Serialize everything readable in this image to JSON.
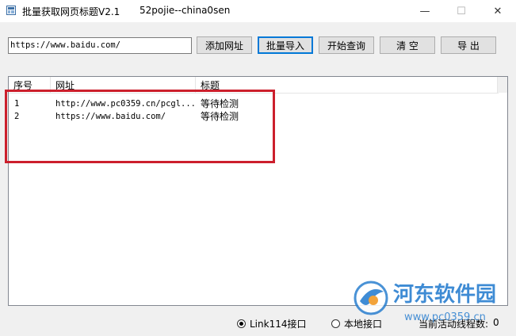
{
  "window": {
    "title": "批量获取网页标题V2.1",
    "subtitle": "52pojie--china0sen",
    "minimize_glyph": "—",
    "maximize_glyph": "☐",
    "close_glyph": "✕"
  },
  "toolbar": {
    "url_value": "https://www.baidu.com/",
    "add_label": "添加网址",
    "batch_import_label": "批量导入",
    "start_query_label": "开始查询",
    "clear_label": "清  空",
    "export_label": "导  出"
  },
  "table": {
    "columns": [
      "序号",
      "网址",
      "标题"
    ],
    "rows": [
      {
        "no": "1",
        "url": "http://www.pc0359.cn/pcgl...",
        "title": "等待检测"
      },
      {
        "no": "2",
        "url": "https://www.baidu.com/",
        "title": "等待检测"
      }
    ]
  },
  "status": {
    "radio_link114": "Link114接口",
    "radio_local": "本地接口",
    "selected": "link114",
    "active_threads_label": "当前活动线程数:",
    "active_threads_value": "0"
  },
  "watermark": {
    "brand_text": "河东软件园",
    "site_text": "www.pc0359.cn",
    "brand_color": "#2a7fd0"
  }
}
